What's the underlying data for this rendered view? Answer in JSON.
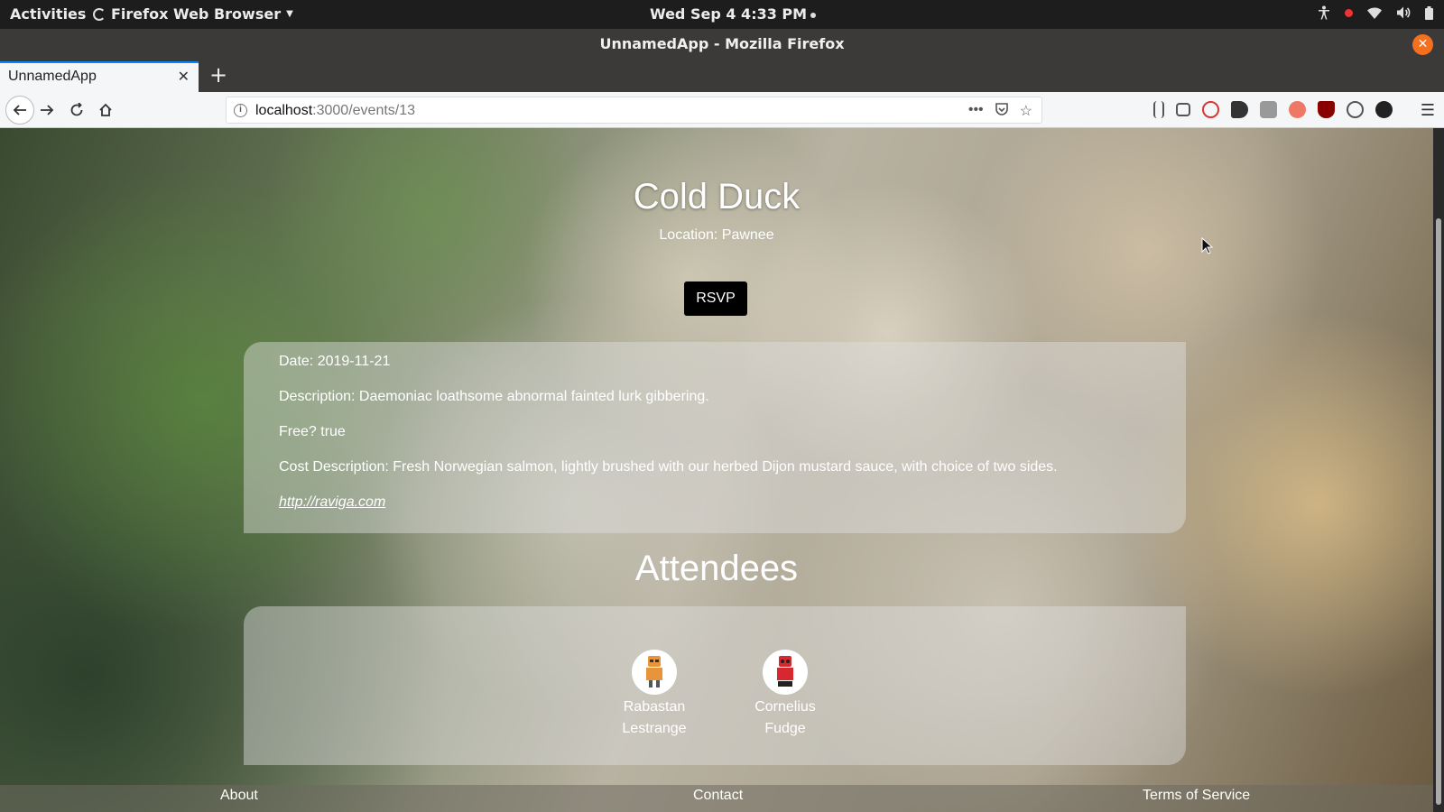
{
  "system": {
    "activities": "Activities",
    "app_name": "Firefox Web Browser",
    "clock": "Wed Sep 4  4:33 PM"
  },
  "window": {
    "title": "UnnamedApp - Mozilla Firefox"
  },
  "browser": {
    "tab_title": "UnnamedApp",
    "url_host": "localhost",
    "url_path": ":3000/events/13"
  },
  "event": {
    "title": "Cold Duck",
    "location": "Location: Pawnee",
    "rsvp_label": "RSVP",
    "date": "Date: 2019-11-21",
    "description": "Description: Daemoniac loathsome abnormal fainted lurk gibbering.",
    "free": "Free? true",
    "cost_description": "Cost Description: Fresh Norwegian salmon, lightly brushed with our herbed Dijon mustard sauce, with choice of two sides.",
    "link": "http://raviga.com"
  },
  "attendees": {
    "heading": "Attendees",
    "list": [
      {
        "first": "Rabastan",
        "last": "Lestrange",
        "avatar_color": "#e8943a"
      },
      {
        "first": "Cornelius",
        "last": "Fudge",
        "avatar_color": "#d8282f"
      }
    ]
  },
  "footer": {
    "about": "About",
    "contact": "Contact",
    "terms": "Terms of Service"
  },
  "colors": {
    "accent_tab": "#0a84ff",
    "close_button": "#f46f1e",
    "rsvp_bg": "#000000"
  }
}
